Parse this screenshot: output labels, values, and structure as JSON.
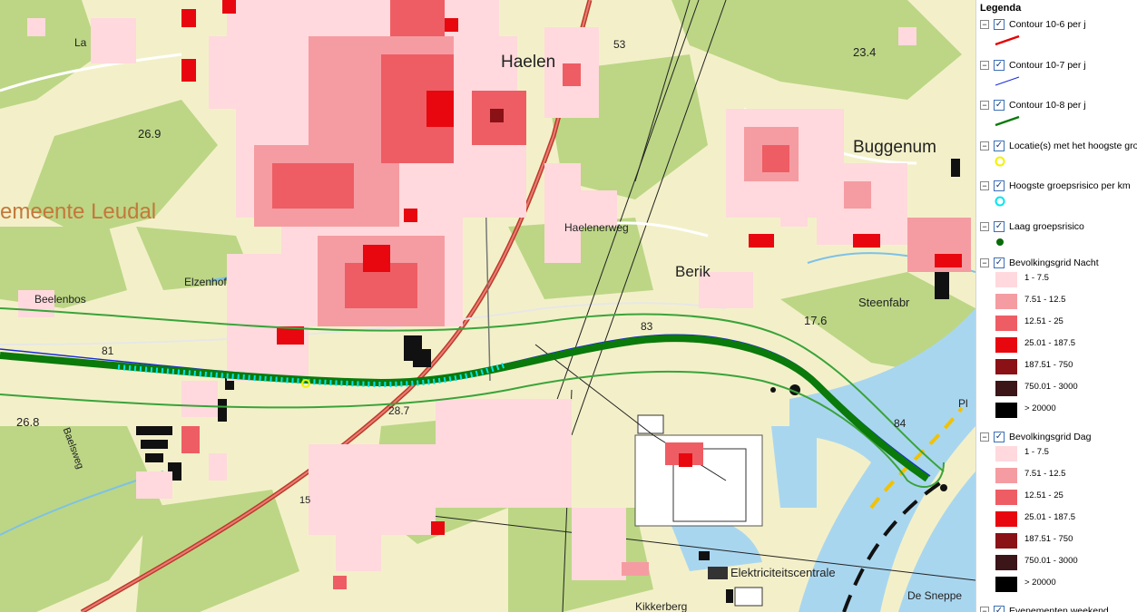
{
  "map": {
    "place_labels": [
      "Buggenum",
      "emeente Leudal",
      "Beelenbos",
      "Elzenhof",
      "Haelenerweg",
      "Berik",
      "Steenfabr",
      "Elektriciteitscentrale",
      "De Sneppe",
      "Kikkerberg",
      "Baelsweg",
      "Haelen",
      "Pl"
    ],
    "numbers": [
      "26.9",
      "23.4",
      "17.6",
      "26.8",
      "28.7",
      "81",
      "83",
      "84",
      "53",
      "15",
      "La"
    ],
    "municipality_color": "#c3783a"
  },
  "legend": {
    "title": "Legenda",
    "layers": [
      {
        "label": "Contour 10-6 per j",
        "symbol": "line",
        "color": "#e60000"
      },
      {
        "label": "Contour 10-7 per j",
        "symbol": "line",
        "color": "#1b2bd6"
      },
      {
        "label": "Contour 10-8 per j",
        "symbol": "line",
        "color": "#0a7a0a"
      },
      {
        "label": "Locatie(s) met het hoogste gro",
        "symbol": "circle",
        "color": "#f2f200"
      },
      {
        "label": "Hoogste groepsrisico per km",
        "symbol": "circle",
        "color": "#00e5ee"
      },
      {
        "label": "Laag groepsrisico",
        "symbol": "dot",
        "color": "#0a6a0a"
      }
    ],
    "grids": [
      {
        "label": "Bevolkingsgrid Nacht",
        "bins": [
          {
            "label": "1 - 7.5",
            "color": "#ffd9dd"
          },
          {
            "label": "7.51 - 12.5",
            "color": "#f59ca2"
          },
          {
            "label": "12.51 - 25",
            "color": "#ee5d64"
          },
          {
            "label": "25.01 - 187.5",
            "color": "#e8070f"
          },
          {
            "label": "187.51 - 750",
            "color": "#8a1116"
          },
          {
            "label": "750.01 - 3000",
            "color": "#3b1518"
          },
          {
            "label": "> 20000",
            "color": "#000000"
          }
        ]
      },
      {
        "label": "Bevolkingsgrid Dag",
        "bins": [
          {
            "label": "1 - 7.5",
            "color": "#ffd9dd"
          },
          {
            "label": "7.51 - 12.5",
            "color": "#f59ca2"
          },
          {
            "label": "12.51 - 25",
            "color": "#ee5d64"
          },
          {
            "label": "25.01 - 187.5",
            "color": "#e8070f"
          },
          {
            "label": "187.51 - 750",
            "color": "#8a1116"
          },
          {
            "label": "750.01 - 3000",
            "color": "#3b1518"
          },
          {
            "label": "> 20000",
            "color": "#000000"
          }
        ]
      }
    ],
    "last_layer": {
      "label": "Evenementen weekend"
    }
  }
}
